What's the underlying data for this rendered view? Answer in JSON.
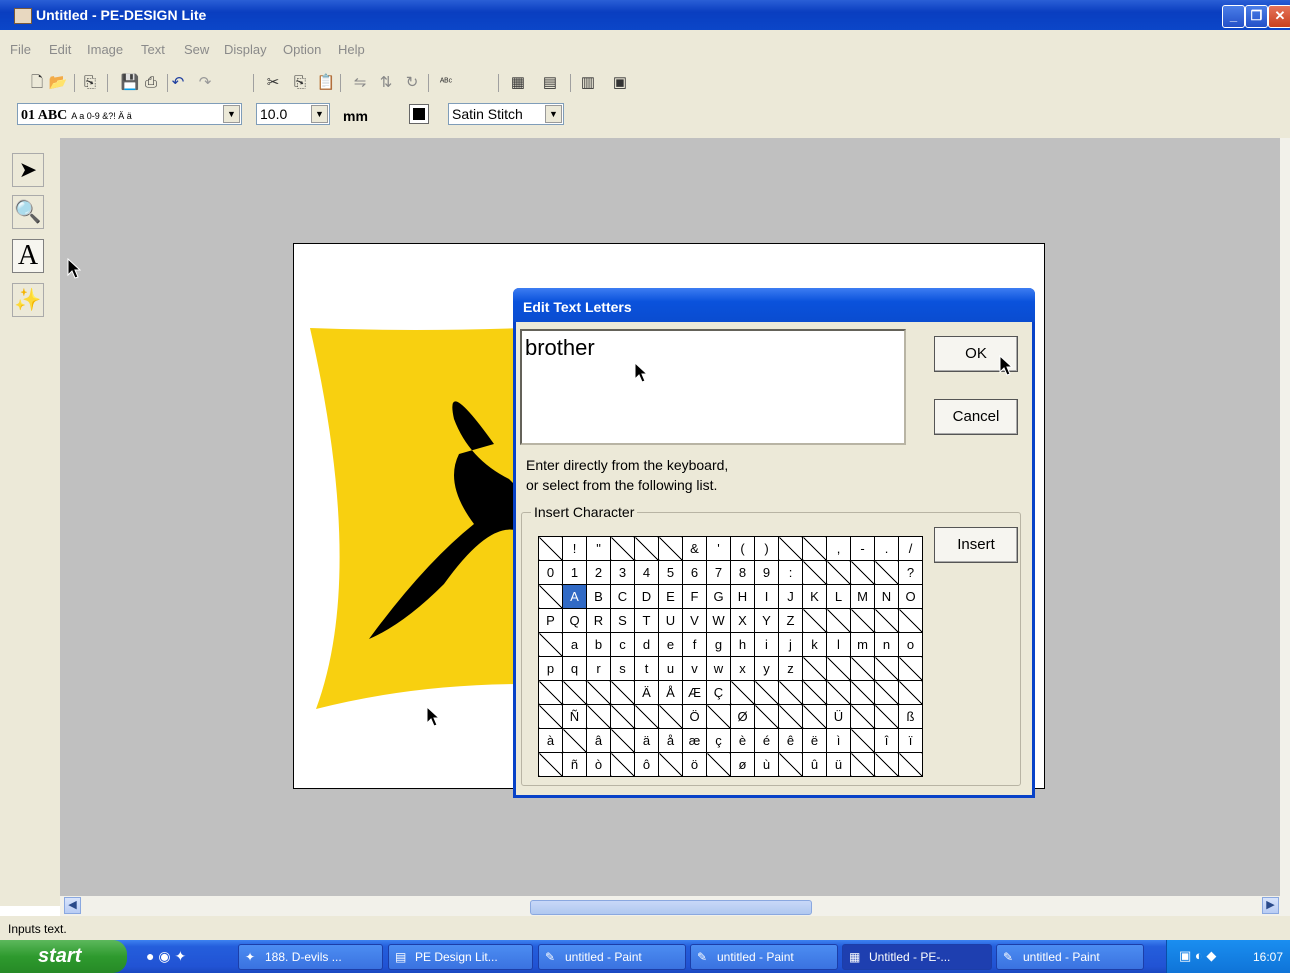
{
  "window": {
    "title": "Untitled - PE-DESIGN Lite"
  },
  "menu": [
    "File",
    "Edit",
    "Image",
    "Text",
    "Sew",
    "Display",
    "Option",
    "Help"
  ],
  "toolbar2": {
    "font_combo": "01 ABC",
    "font_sample": "A a 0-9 &?! Ä ä",
    "size_value": "10.0",
    "unit": "mm",
    "stitch_value": "Satin Stitch"
  },
  "dialog": {
    "title": "Edit Text Letters",
    "text_value": "brother",
    "ok_label": "OK",
    "cancel_label": "Cancel",
    "hint_line1": "Enter directly from the keyboard,",
    "hint_line2": "or select from the following list.",
    "group_label": "Insert Character",
    "insert_label": "Insert",
    "selected_char": "A",
    "char_rows": [
      [
        "",
        "!",
        "\"",
        "",
        "",
        "",
        "&",
        "'",
        "(",
        ")",
        "",
        "",
        ",",
        "-",
        ".",
        "/"
      ],
      [
        "0",
        "1",
        "2",
        "3",
        "4",
        "5",
        "6",
        "7",
        "8",
        "9",
        ":",
        "",
        "",
        "",
        "",
        "?"
      ],
      [
        "",
        "A",
        "B",
        "C",
        "D",
        "E",
        "F",
        "G",
        "H",
        "I",
        "J",
        "K",
        "L",
        "M",
        "N",
        "O"
      ],
      [
        "P",
        "Q",
        "R",
        "S",
        "T",
        "U",
        "V",
        "W",
        "X",
        "Y",
        "Z",
        "",
        "",
        "",
        "",
        ""
      ],
      [
        "",
        "a",
        "b",
        "c",
        "d",
        "e",
        "f",
        "g",
        "h",
        "i",
        "j",
        "k",
        "l",
        "m",
        "n",
        "o"
      ],
      [
        "p",
        "q",
        "r",
        "s",
        "t",
        "u",
        "v",
        "w",
        "x",
        "y",
        "z",
        "",
        "",
        "",
        "",
        ""
      ],
      [
        "",
        "",
        "",
        "",
        "Ä",
        "Å",
        "Æ",
        "Ç",
        "",
        "",
        "",
        "",
        "",
        "",
        "",
        ""
      ],
      [
        "",
        "Ñ",
        "",
        "",
        "",
        "",
        "Ö",
        "",
        "Ø",
        "",
        "",
        "",
        "Ü",
        "",
        "",
        "ß"
      ],
      [
        "à",
        "",
        "â",
        "",
        "ä",
        "å",
        "æ",
        "ç",
        "è",
        "é",
        "ê",
        "ë",
        "ì",
        "",
        "î",
        "ï"
      ],
      [
        "",
        "ñ",
        "ò",
        "",
        "ô",
        "",
        "ö",
        "",
        "ø",
        "ù",
        "",
        "û",
        "ü",
        "",
        "",
        ""
      ]
    ]
  },
  "status": "Inputs text.",
  "taskbar": {
    "start_label": "start",
    "tasks": [
      "188. D-evils ...",
      "PE Design Lit...",
      "untitled - Paint",
      "untitled - Paint",
      "Untitled - PE-...",
      "untitled - Paint"
    ],
    "clock": "16:07"
  },
  "colors": {
    "flag_yellow": "#f8d010",
    "title_blue": "#0a4cd0",
    "selection_blue": "#316ac5"
  }
}
